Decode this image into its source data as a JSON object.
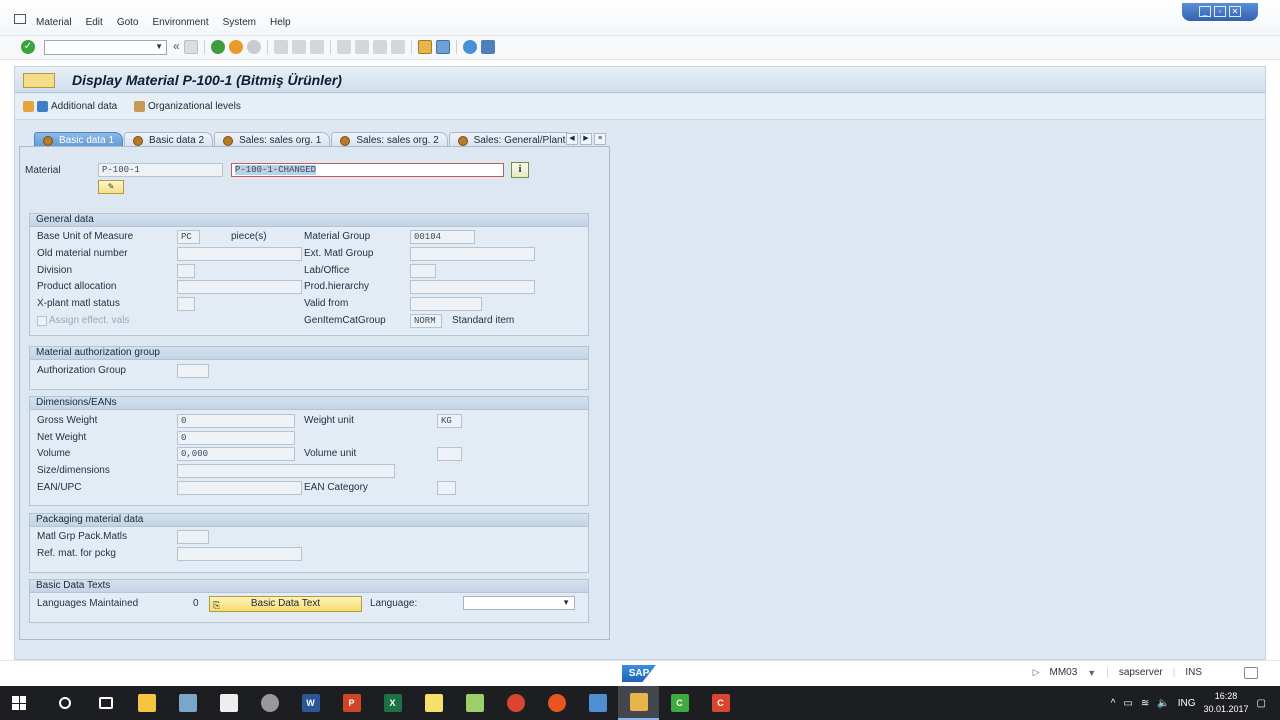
{
  "menu": {
    "items": [
      "Material",
      "Edit",
      "Goto",
      "Environment",
      "System",
      "Help"
    ]
  },
  "toolbar": {
    "command_field": ""
  },
  "screen": {
    "title": "Display Material P-100-1 (Bitmiş Ürünler)"
  },
  "appbar": {
    "additional_data": "Additional data",
    "org_levels": "Organizational levels"
  },
  "tabs": [
    "Basic data 1",
    "Basic data 2",
    "Sales: sales org. 1",
    "Sales: sales org. 2",
    "Sales: General/Plant"
  ],
  "active_tab": "Basic data 1",
  "header": {
    "material_label": "Material",
    "material_value": "P-100-1",
    "description_value": "P-100-1-CHANGED"
  },
  "general": {
    "title": "General data",
    "base_uom_label": "Base Unit of Measure",
    "base_uom_value": "PC",
    "base_uom_text": "piece(s)",
    "old_material_label": "Old material number",
    "division_label": "Division",
    "product_allocation_label": "Product allocation",
    "xplant_status_label": "X-plant matl status",
    "assign_effect_label": "Assign effect. vals",
    "material_group_label": "Material Group",
    "material_group_value": "00104",
    "ext_matl_group_label": "Ext. Matl Group",
    "lab_office_label": "Lab/Office",
    "prod_hierarchy_label": "Prod.hierarchy",
    "valid_from_label": "Valid from",
    "gen_item_cat_label": "GenItemCatGroup",
    "gen_item_cat_value": "NORM",
    "gen_item_cat_text": "Standard item"
  },
  "authorization": {
    "title": "Material authorization group",
    "auth_group_label": "Authorization Group"
  },
  "dimensions": {
    "title": "Dimensions/EANs",
    "gross_weight_label": "Gross Weight",
    "gross_weight_value": "0",
    "net_weight_label": "Net Weight",
    "net_weight_value": "0",
    "volume_label": "Volume",
    "volume_value": "0,000",
    "size_label": "Size/dimensions",
    "ean_label": "EAN/UPC",
    "weight_unit_label": "Weight unit",
    "weight_unit_value": "KG",
    "volume_unit_label": "Volume unit",
    "ean_category_label": "EAN Category"
  },
  "packaging": {
    "title": "Packaging material data",
    "matl_grp_label": "Matl Grp Pack.Matls",
    "ref_mat_label": "Ref. mat. for pckg"
  },
  "texts": {
    "title": "Basic Data Texts",
    "languages_label": "Languages Maintained",
    "languages_count": "0",
    "basic_text_button": "Basic Data Text",
    "language_label": "Language:"
  },
  "statusbar": {
    "logo": "SAP",
    "transaction": "MM03",
    "server": "sapserver",
    "mode": "INS"
  },
  "taskbar": {
    "time": "16:28",
    "date": "30.01.2017"
  }
}
